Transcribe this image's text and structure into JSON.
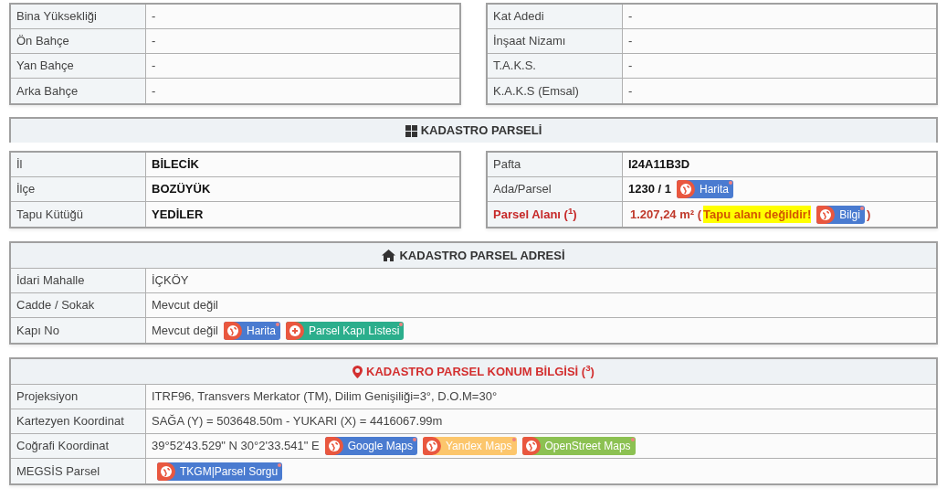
{
  "top_tables": [
    {
      "rows": [
        {
          "label": "Bina Yüksekliği",
          "kind": "plain",
          "value": [
            {
              "kind": "text",
              "text": "-"
            }
          ]
        },
        {
          "label": "Ön Bahçe",
          "kind": "plain",
          "value": [
            {
              "kind": "text",
              "text": "-"
            }
          ]
        },
        {
          "label": "Yan Bahçe",
          "kind": "plain",
          "value": [
            {
              "kind": "text",
              "text": "-"
            }
          ]
        },
        {
          "label": "Arka Bahçe",
          "kind": "plain",
          "value": [
            {
              "kind": "text",
              "text": "-"
            }
          ]
        }
      ]
    },
    {
      "rows": [
        {
          "label": "Kat Adedi",
          "kind": "plain",
          "value": [
            {
              "kind": "text",
              "text": "-"
            }
          ]
        },
        {
          "label": "İnşaat Nizamı",
          "kind": "plain",
          "value": [
            {
              "kind": "text",
              "text": "-"
            }
          ]
        },
        {
          "label": "T.A.K.S.",
          "kind": "plain",
          "value": [
            {
              "kind": "text",
              "text": "-"
            }
          ]
        },
        {
          "label": "K.A.K.S (Emsal)",
          "kind": "plain",
          "value": [
            {
              "kind": "text",
              "text": "-"
            }
          ]
        }
      ]
    }
  ],
  "sections": [
    {
      "title": "KADASTRO PARSELİ",
      "kind": "split",
      "tables": [
        {
          "rows": [
            {
              "label": "İl",
              "kind": "bold",
              "value": [
                {
                  "kind": "text",
                  "text": "BİLECİK"
                }
              ]
            },
            {
              "label": "İlçe",
              "kind": "bold",
              "value": [
                {
                  "kind": "text",
                  "text": "BOZÜYÜK"
                }
              ]
            },
            {
              "label": "Tapu Kütüğü",
              "kind": "bold",
              "value": [
                {
                  "kind": "text",
                  "text": "YEDİLER"
                }
              ]
            }
          ]
        },
        {
          "rows": [
            {
              "label": "Pafta",
              "kind": "bold",
              "value": [
                {
                  "kind": "text",
                  "text": "I24A11B3D"
                }
              ]
            },
            {
              "label": "Ada/Parsel",
              "kind": "bold",
              "value": [
                {
                  "kind": "text",
                  "text": "1230 / 1"
                },
                {
                  "kind": "button",
                  "text": "Harita",
                  "color": "#4a7bd0"
                }
              ]
            },
            {
              "label": "Parsel Alanı ($^{1}$)",
              "kind": "alert",
              "value": [
                {
                  "kind": "text",
                  "text": "1.207,24 m² ("
                },
                {
                  "kind": "highlight",
                  "text": "Tapu alanı değildir!"
                },
                {
                  "kind": "button",
                  "text": "Bilgi",
                  "color": "#4a7bd0"
                },
                {
                  "kind": "text",
                  "text": ")"
                }
              ]
            }
          ]
        }
      ]
    },
    {
      "title": "KADASTRO PARSEL ADRESİ",
      "kind": "full",
      "tables": [
        {
          "rows": [
            {
              "label": "İdari Mahalle",
              "kind": "plain",
              "value": [
                {
                  "kind": "text",
                  "text": "İÇKÖY"
                }
              ]
            },
            {
              "label": "Cadde / Sokak",
              "kind": "plain",
              "value": [
                {
                  "kind": "text",
                  "text": "Mevcut değil"
                }
              ]
            },
            {
              "label": "Kapı No",
              "kind": "plain",
              "value": [
                {
                  "kind": "text",
                  "text": "Mevcut değil"
                },
                {
                  "kind": "button",
                  "text": "Harita",
                  "color": "#4a7bd0"
                },
                {
                  "kind": "plus-button",
                  "text": "Parsel Kapı Listesi",
                  "color": "#2bae8c"
                }
              ]
            }
          ]
        }
      ]
    },
    {
      "title": "KADASTRO PARSEL KONUM BİLGİSİ ($^{3}$)",
      "kind": "full",
      "tables": [
        {
          "rows": [
            {
              "label": "Projeksiyon",
              "kind": "plain",
              "value": [
                {
                  "kind": "text",
                  "text": "ITRF96, Transvers Merkator (TM), Dilim Genişiliği=3°, D.O.M=30°"
                }
              ]
            },
            {
              "label": "Kartezyen Koordinat",
              "kind": "plain",
              "value": [
                {
                  "kind": "text",
                  "text": "SAĞA (Y) = 503648.50m - YUKARI (X) = 4416067.99m"
                }
              ]
            },
            {
              "label": "Coğrafi Koordinat",
              "kind": "plain",
              "value": [
                {
                  "kind": "text",
                  "text": "39°52'43.529\" N 30°2'33.541\" E"
                },
                {
                  "kind": "button",
                  "text": "Google Maps",
                  "color": "#4a7bd0"
                },
                {
                  "kind": "button",
                  "text": "Yandex Maps",
                  "color": "#fcc66c"
                },
                {
                  "kind": "button",
                  "text": "OpenStreet Maps",
                  "color": "#8cc152"
                }
              ]
            },
            {
              "label": "MEGSİS Parsel",
              "kind": "plain",
              "value": [
                {
                  "kind": "button",
                  "text": "TKGM|Parsel Sorgu",
                  "color": "#4a7bd0"
                }
              ]
            }
          ]
        }
      ]
    }
  ]
}
